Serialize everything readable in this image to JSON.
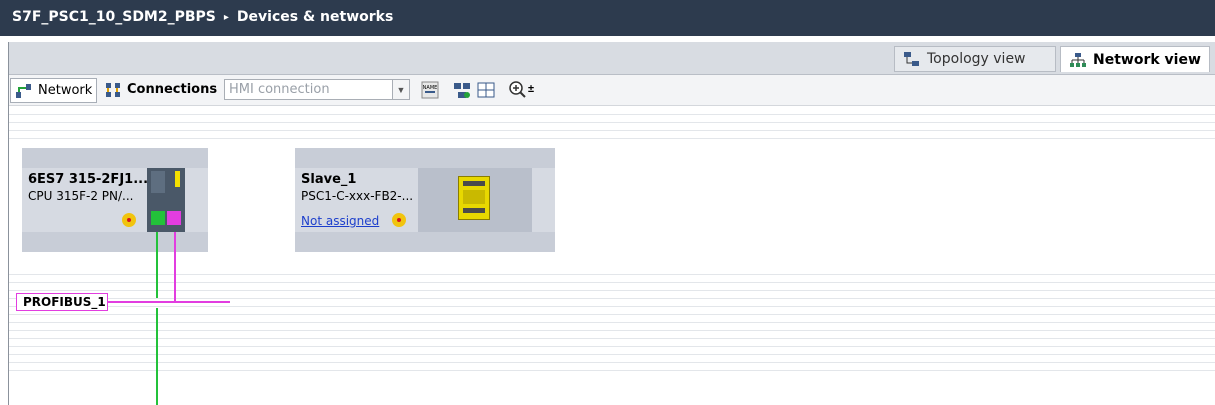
{
  "header": {
    "project": "S7F_PSC1_10_SDM2_PBPS",
    "separator": "▸",
    "page": "Devices & networks"
  },
  "views": {
    "topology_label": "Topology view",
    "network_label": "Network view"
  },
  "toolbar": {
    "network_label": "Network",
    "connections_label": "Connections",
    "connection_type_placeholder": "HMI connection"
  },
  "devices": {
    "plc": {
      "name": "6ES7 315-2FJ1...",
      "type": "CPU 315F-2 PN/..."
    },
    "slave": {
      "name": "Slave_1",
      "type": "PSC1-C-xxx-FB2-...",
      "assignment": "Not assigned"
    }
  },
  "network": {
    "bus_label": "PROFIBUS_1",
    "bus_color": "#e23de0",
    "ethernet_color": "#23c23a"
  },
  "colors": {
    "titlebar": "#2d3b4e",
    "device_bg": "#d6dae2"
  }
}
